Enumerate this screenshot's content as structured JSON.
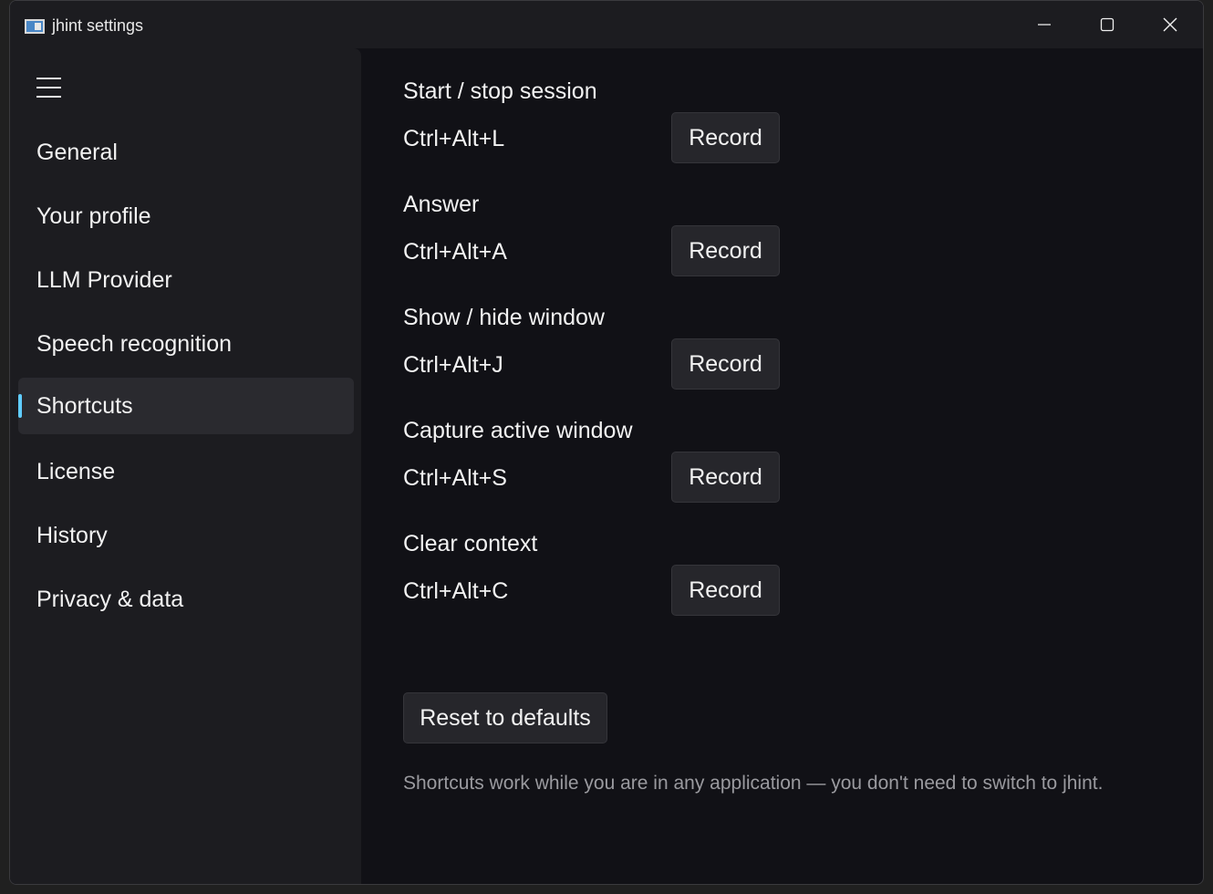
{
  "window": {
    "title": "jhint settings"
  },
  "sidebar": {
    "items": [
      {
        "label": "General",
        "active": false
      },
      {
        "label": "Your profile",
        "active": false
      },
      {
        "label": "LLM Provider",
        "active": false
      },
      {
        "label": "Speech recognition",
        "active": false
      },
      {
        "label": "Shortcuts",
        "active": true
      },
      {
        "label": "License",
        "active": false
      },
      {
        "label": "History",
        "active": false
      },
      {
        "label": "Privacy & data",
        "active": false
      }
    ]
  },
  "shortcuts": [
    {
      "title": "Start / stop session",
      "key": "Ctrl+Alt+L",
      "button": "Record"
    },
    {
      "title": "Answer",
      "key": "Ctrl+Alt+A",
      "button": "Record"
    },
    {
      "title": "Show / hide window",
      "key": "Ctrl+Alt+J",
      "button": "Record"
    },
    {
      "title": "Capture active window",
      "key": "Ctrl+Alt+S",
      "button": "Record"
    },
    {
      "title": "Clear context",
      "key": "Ctrl+Alt+C",
      "button": "Record"
    }
  ],
  "actions": {
    "reset_label": "Reset to defaults"
  },
  "footnote": "Shortcuts work while you are in any application — you don't need to switch to jhint.",
  "colors": {
    "accent": "#60cdff",
    "background": "#111116",
    "sidebar": "#1c1c20"
  },
  "icons": {
    "app": "app-window-icon",
    "menu": "hamburger-menu-icon",
    "minimize": "minimize-icon",
    "maximize": "maximize-icon",
    "close": "close-icon"
  }
}
